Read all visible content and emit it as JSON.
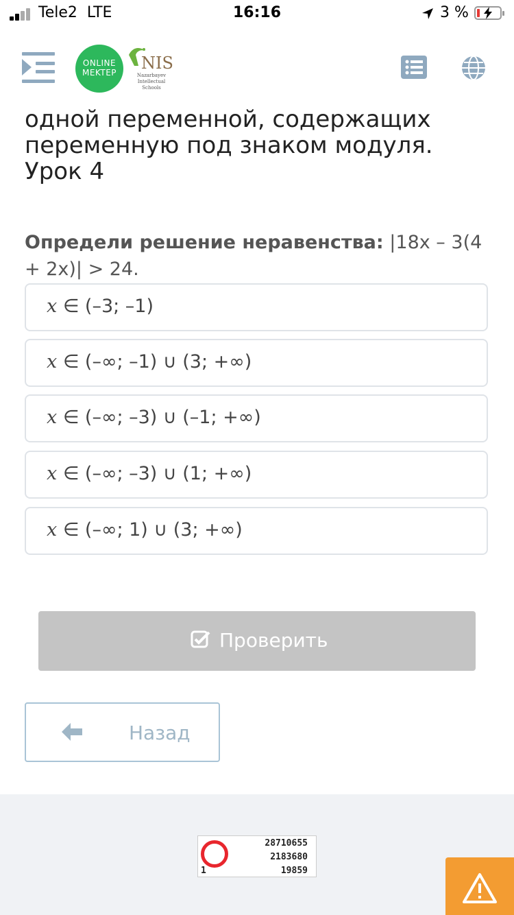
{
  "status_bar": {
    "carrier": "Tele2",
    "network": "LTE",
    "time": "16:16",
    "battery_percent": "3 %"
  },
  "header": {
    "logo_line1": "ONLINE",
    "logo_line2": "MEKTEP",
    "partner_logo": "NIS",
    "partner_sub": "Nazarbayev Intellectual Schools",
    "icons": [
      "menu-icon",
      "list-icon",
      "globe-icon"
    ]
  },
  "lesson": {
    "title": "одной переменной, содержащих переменную под знаком модуля. Урок 4"
  },
  "question": {
    "prompt": "Определи решение неравенства:",
    "expression": "|18x – 3(4 + 2x)| > 24."
  },
  "options": [
    {
      "var": "x",
      "rest": " ∈ (–3; –1)"
    },
    {
      "var": "x",
      "rest": " ∈ (–∞; –1) ∪ (3; +∞)"
    },
    {
      "var": "x",
      "rest": " ∈ (–∞; –3) ∪ (–1; +∞)"
    },
    {
      "var": "x",
      "rest": " ∈ (–∞; –3) ∪ (1; +∞)"
    },
    {
      "var": "x",
      "rest": " ∈ (–∞; 1) ∪ (3; +∞)"
    }
  ],
  "actions": {
    "check_label": "Проверить",
    "back_label": "Назад"
  },
  "counter": {
    "line1": "28710655",
    "line2": "2183680",
    "rank": "1",
    "line3": "19859"
  },
  "colors": {
    "brand_green": "#2db85c",
    "check_button_disabled": "#c4c4c4",
    "warning_orange": "#f39c32"
  }
}
